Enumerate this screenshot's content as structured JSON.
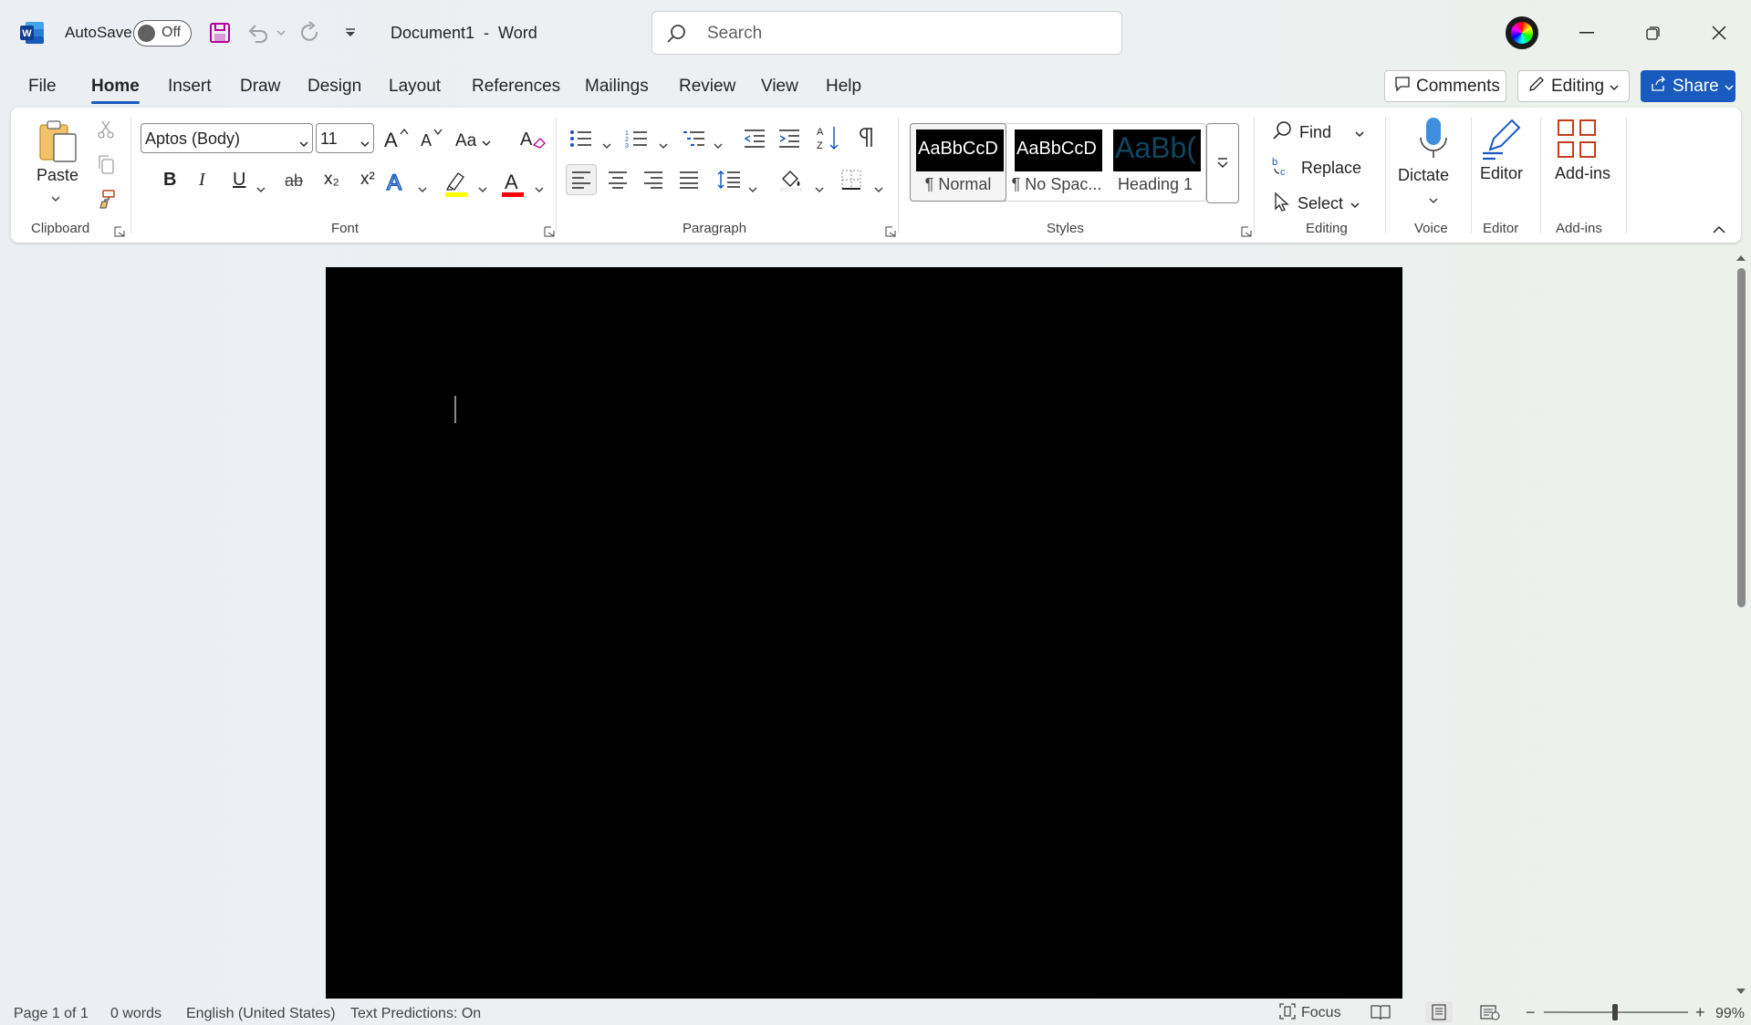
{
  "app": {
    "autosave_label": "AutoSave",
    "autosave_state": "Off",
    "doc_title": "Document1  -  Word"
  },
  "search": {
    "placeholder": "Search"
  },
  "tabs": [
    "File",
    "Home",
    "Insert",
    "Draw",
    "Design",
    "Layout",
    "References",
    "Mailings",
    "Review",
    "View",
    "Help"
  ],
  "active_tab": "Home",
  "actions": {
    "comments": "Comments",
    "editing": "Editing",
    "share": "Share"
  },
  "ribbon": {
    "clipboard": {
      "label": "Clipboard",
      "paste": "Paste"
    },
    "font": {
      "label": "Font",
      "font_name": "Aptos (Body)",
      "font_size": "11",
      "bold": "B",
      "italic": "I",
      "underline": "U",
      "strike": "ab",
      "subscript": "x₂",
      "superscript": "x²",
      "change_case": "Aa"
    },
    "paragraph": {
      "label": "Paragraph"
    },
    "styles": {
      "label": "Styles",
      "items": [
        {
          "sample": "AaBbCcD",
          "name": "¶ Normal"
        },
        {
          "sample": "AaBbCcD",
          "name": "¶ No Spac..."
        },
        {
          "sample": "AaBb(",
          "name": "Heading 1"
        }
      ]
    },
    "editing": {
      "label": "Editing",
      "find": "Find",
      "replace": "Replace",
      "select": "Select"
    },
    "voice": {
      "label": "Voice",
      "dictate": "Dictate"
    },
    "editor": {
      "label": "Editor",
      "editor": "Editor"
    },
    "addins": {
      "label": "Add-ins",
      "addins": "Add-ins"
    }
  },
  "status": {
    "page": "Page 1 of 1",
    "words": "0 words",
    "language": "English (United States)",
    "predictions": "Text Predictions: On",
    "focus": "Focus",
    "zoom": "99%",
    "zoom_level": 0.99
  },
  "colors": {
    "accent": "#185abd",
    "highlight": "#ffff00",
    "font_color": "#ff0000",
    "document": "#000000"
  }
}
